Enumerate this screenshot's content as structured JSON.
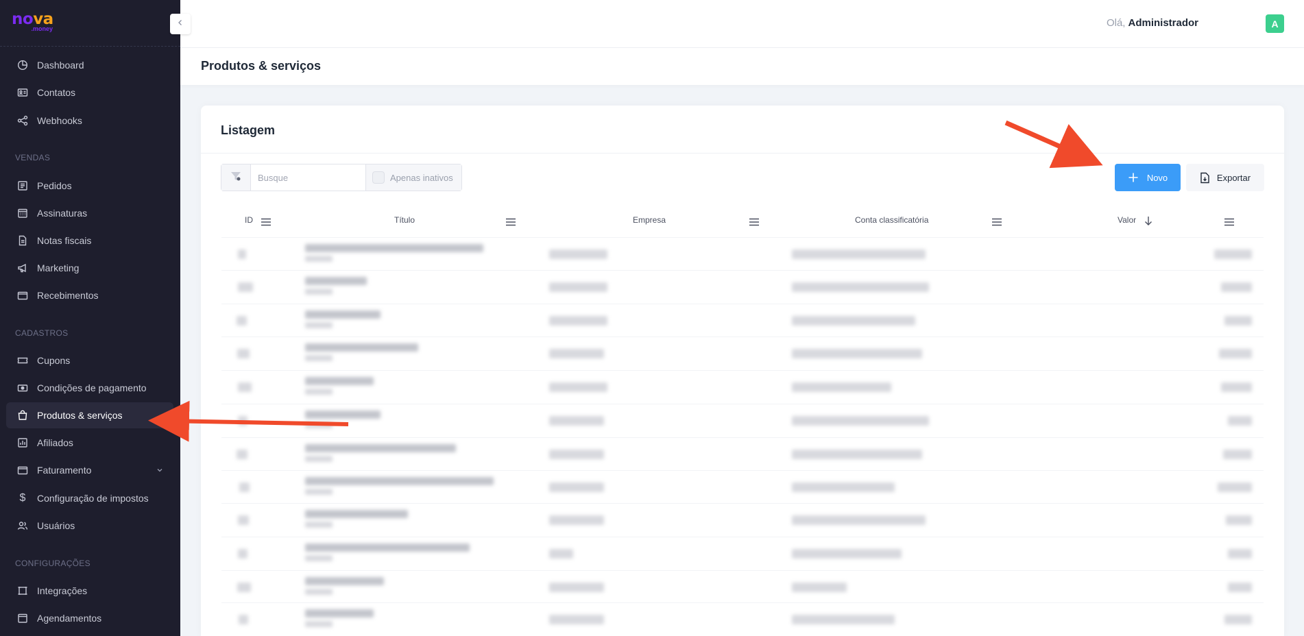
{
  "brand": {
    "logo_main_part1": "no",
    "logo_main_part2": "va",
    "logo_sub": ".money"
  },
  "sidebar": {
    "items": [
      {
        "label": "Dashboard",
        "icon": "dashboard-icon"
      },
      {
        "label": "Contatos",
        "icon": "contact-card-icon"
      },
      {
        "label": "Webhooks",
        "icon": "share-icon"
      }
    ],
    "sections": [
      {
        "title": "VENDAS",
        "items": [
          {
            "label": "Pedidos",
            "icon": "receipt-icon"
          },
          {
            "label": "Assinaturas",
            "icon": "calendar-icon"
          },
          {
            "label": "Notas fiscais",
            "icon": "document-icon"
          },
          {
            "label": "Marketing",
            "icon": "megaphone-icon"
          },
          {
            "label": "Recebimentos",
            "icon": "folder-icon"
          }
        ]
      },
      {
        "title": "CADASTROS",
        "items": [
          {
            "label": "Cupons",
            "icon": "ticket-icon"
          },
          {
            "label": "Condições de pagamento",
            "icon": "money-icon"
          },
          {
            "label": "Produtos & serviços",
            "icon": "shopping-bag-icon",
            "active": true
          },
          {
            "label": "Afiliados",
            "icon": "chart-icon"
          },
          {
            "label": "Faturamento",
            "icon": "folder-icon",
            "has_submenu": true
          },
          {
            "label": "Configuração de impostos",
            "icon": "dollar-icon"
          },
          {
            "label": "Usuários",
            "icon": "users-icon"
          }
        ]
      },
      {
        "title": "CONFIGURAÇÕES",
        "items": [
          {
            "label": "Integrações",
            "icon": "integration-icon"
          },
          {
            "label": "Agendamentos",
            "icon": "calendar-icon"
          }
        ]
      }
    ]
  },
  "header": {
    "greeting": "Olá,",
    "user_name": "Administrador",
    "avatar_letter": "A",
    "avatar_color": "#3ccf8e"
  },
  "page": {
    "title": "Produtos & serviços"
  },
  "listing": {
    "title": "Listagem",
    "search_placeholder": "Busque",
    "inactive_label": "Apenas inativos",
    "new_button": "Novo",
    "export_button": "Exportar",
    "columns": [
      "ID",
      "Título",
      "Empresa",
      "Conta classificatória",
      "Valor"
    ],
    "sorted_column": "Valor",
    "sort_direction": "desc"
  },
  "colors": {
    "accent": "#3b9cf8",
    "sidebar_bg": "#1e1e2d",
    "annotation": "#f04a2b"
  }
}
